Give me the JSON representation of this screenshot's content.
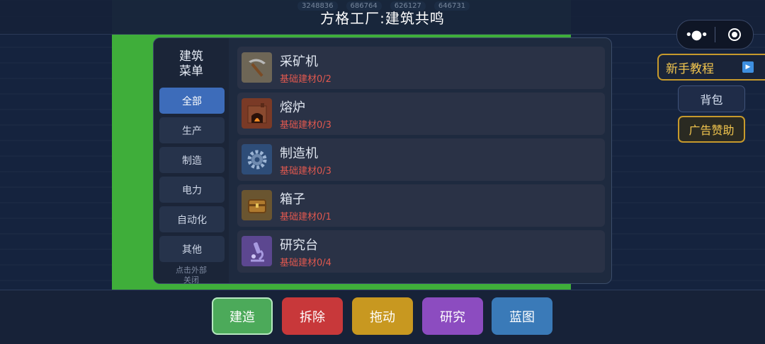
{
  "background": {
    "counters": [
      "3248836",
      "686764",
      "626127",
      "646731"
    ]
  },
  "header": {
    "title": "方格工厂:建筑共鸣"
  },
  "capsule": {
    "more_icon": "more-dots-icon",
    "close_icon": "target-circle-icon"
  },
  "side": {
    "tutorial_label": "新手教程",
    "bag_label": "背包",
    "ad_label": "广告赞助"
  },
  "menu": {
    "title": "建筑\n菜单",
    "categories": [
      "全部",
      "生产",
      "制造",
      "电力",
      "自动化",
      "其他"
    ],
    "active_category": "全部",
    "close_hint": "点击外部\n关闭",
    "items": [
      {
        "name": "采矿机",
        "cost": "基础建材0/2",
        "icon": "pickaxe-icon"
      },
      {
        "name": "熔炉",
        "cost": "基础建材0/3",
        "icon": "furnace-icon"
      },
      {
        "name": "制造机",
        "cost": "基础建材0/3",
        "icon": "gear-icon"
      },
      {
        "name": "箱子",
        "cost": "基础建材0/1",
        "icon": "chest-icon"
      },
      {
        "name": "研究台",
        "cost": "基础建材0/4",
        "icon": "microscope-icon"
      }
    ]
  },
  "actions": [
    {
      "label": "建造",
      "color": "#4caa5a"
    },
    {
      "label": "拆除",
      "color": "#c8383a"
    },
    {
      "label": "拖动",
      "color": "#c89820"
    },
    {
      "label": "研究",
      "color": "#8c4cc0"
    },
    {
      "label": "蓝图",
      "color": "#3a7ab8"
    }
  ]
}
